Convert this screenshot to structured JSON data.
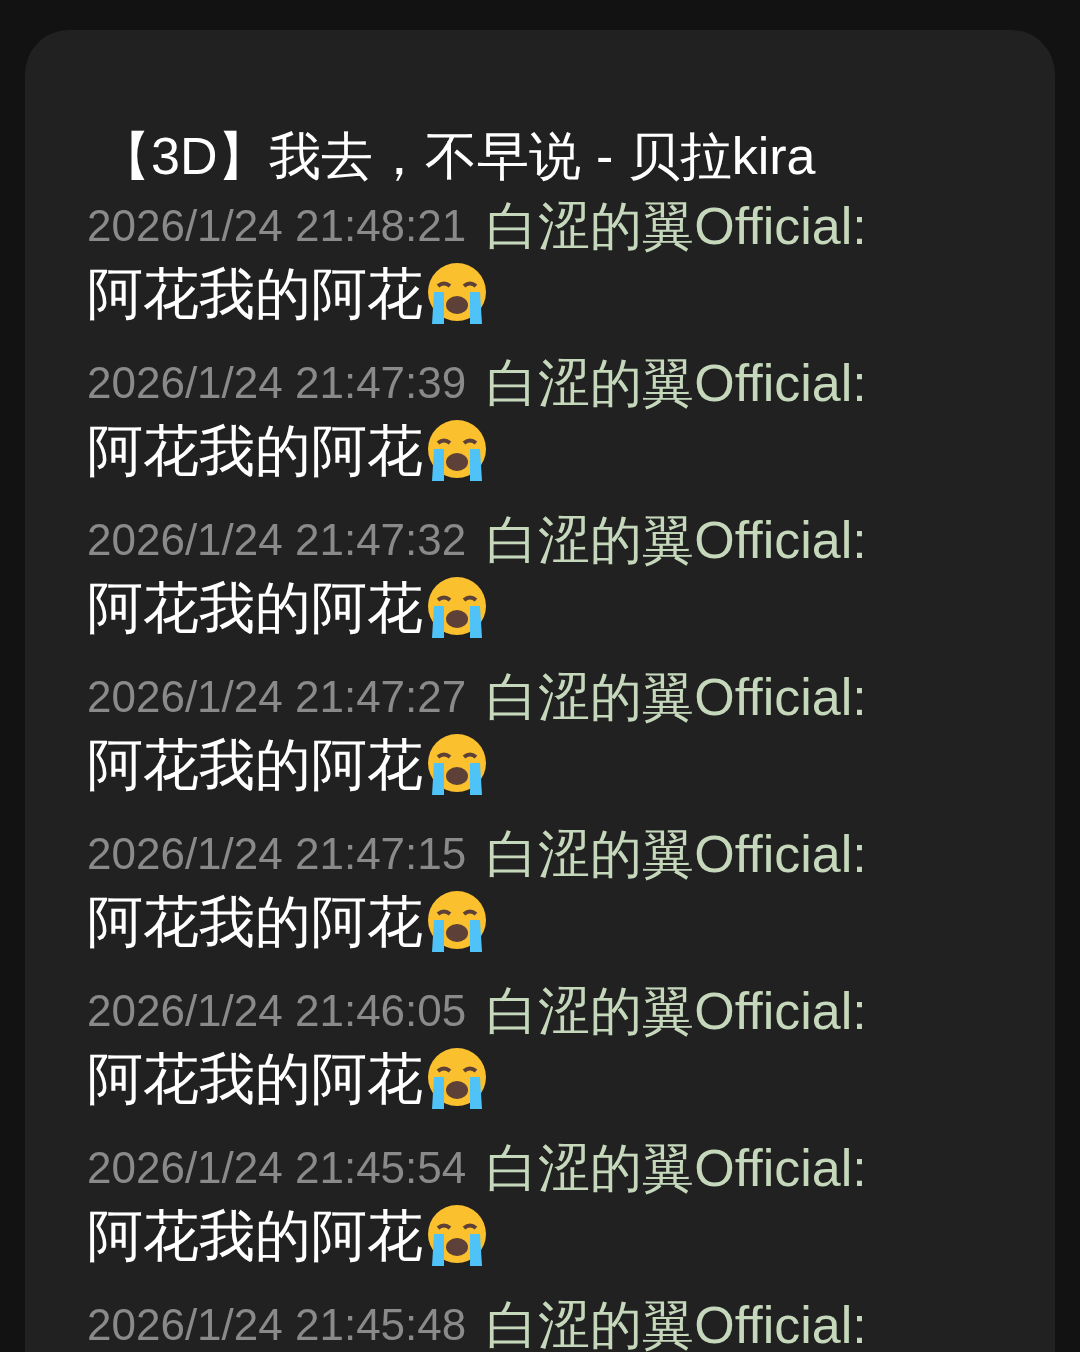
{
  "title": "【3D】我去，不早说 - 贝拉kira",
  "messages": [
    {
      "time": "2026/1/24 21:48:21",
      "user": "白涩的翼Official:",
      "text": "阿花我的阿花"
    },
    {
      "time": "2026/1/24 21:47:39",
      "user": "白涩的翼Official:",
      "text": "阿花我的阿花"
    },
    {
      "time": "2026/1/24 21:47:32",
      "user": "白涩的翼Official:",
      "text": "阿花我的阿花"
    },
    {
      "time": "2026/1/24 21:47:27",
      "user": "白涩的翼Official:",
      "text": "阿花我的阿花"
    },
    {
      "time": "2026/1/24 21:47:15",
      "user": "白涩的翼Official:",
      "text": "阿花我的阿花"
    },
    {
      "time": "2026/1/24 21:46:05",
      "user": "白涩的翼Official:",
      "text": "阿花我的阿花"
    },
    {
      "time": "2026/1/24 21:45:54",
      "user": "白涩的翼Official:",
      "text": "阿花我的阿花"
    },
    {
      "time": "2026/1/24 21:45:48",
      "user": "白涩的翼Official:"
    }
  ]
}
